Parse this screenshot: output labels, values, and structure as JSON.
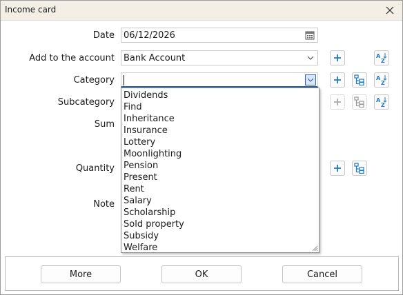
{
  "window": {
    "title": "Income card"
  },
  "form": {
    "date": {
      "label": "Date",
      "value": "06/12/2026"
    },
    "account": {
      "label": "Add to the account",
      "value": "Bank Account"
    },
    "category": {
      "label": "Category",
      "value": ""
    },
    "subcategory": {
      "label": "Subcategory"
    },
    "sum": {
      "label": "Sum"
    },
    "quantity": {
      "label": "Quantity"
    },
    "note": {
      "label": "Note"
    }
  },
  "dropdown": {
    "options": [
      "Dividends",
      "Find",
      "Inheritance",
      "Insurance",
      "Lottery",
      "Moonlighting",
      "Pension",
      "Present",
      "Rent",
      "Salary",
      "Scholarship",
      "Sold property",
      "Subsidy",
      "Welfare"
    ]
  },
  "buttons": {
    "more": "More",
    "ok": "OK",
    "cancel": "Cancel"
  },
  "icons": {
    "add": "plus-icon",
    "sort": "sort-az-icon",
    "tree": "tree-list-icon",
    "calendar": "calendar-icon",
    "chevron": "chevron-down-icon",
    "close": "close-icon"
  },
  "colors": {
    "accent": "#2f62b8",
    "icon_blue": "#1e7bc0",
    "titlebar": "#f3efe6"
  }
}
